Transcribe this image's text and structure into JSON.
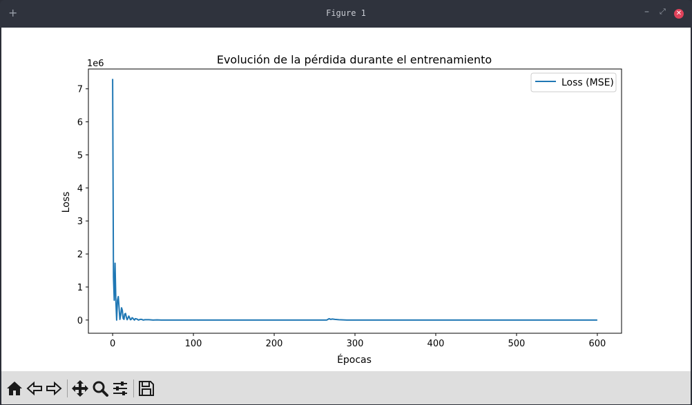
{
  "window": {
    "title": "Figure 1",
    "controls": {
      "add": "+",
      "minimize": "–",
      "maximize": "⤢",
      "close": "✕"
    }
  },
  "toolbar": {
    "icons": [
      "home-icon",
      "back-arrow-icon",
      "forward-arrow-icon",
      "pan-icon",
      "zoom-icon",
      "configure-subplots-icon",
      "save-icon"
    ]
  },
  "chart_data": {
    "type": "line",
    "title": "Evolución de la pérdida durante el entrenamiento",
    "xlabel": "Épocas",
    "ylabel": "Loss",
    "y_offset_label": "1e6",
    "xlim": [
      -30,
      630
    ],
    "ylim": [
      -0.4,
      7.6
    ],
    "xticks": [
      0,
      100,
      200,
      300,
      400,
      500,
      600
    ],
    "yticks": [
      0,
      1,
      2,
      3,
      4,
      5,
      6,
      7
    ],
    "legend": {
      "position": "top-right",
      "entries": [
        "Loss (MSE)"
      ]
    },
    "grid": false,
    "series": [
      {
        "name": "Loss (MSE)",
        "color": "#1f77b4",
        "x": [
          0,
          1,
          2,
          3,
          4,
          5,
          6,
          7,
          8,
          9,
          10,
          11,
          12,
          13,
          14,
          15,
          16,
          17,
          18,
          19,
          20,
          21,
          22,
          23,
          24,
          25,
          26,
          27,
          28,
          30,
          32,
          34,
          36,
          38,
          40,
          45,
          50,
          55,
          60,
          70,
          80,
          100,
          150,
          200,
          250,
          265,
          268,
          270,
          272,
          275,
          280,
          290,
          300,
          400,
          500,
          600
        ],
        "y": [
          7.3,
          1.3,
          0.6,
          1.72,
          0.55,
          0.0,
          0.6,
          0.71,
          0.38,
          0.02,
          0.15,
          0.37,
          0.3,
          0.05,
          0.02,
          0.18,
          0.2,
          0.08,
          0.01,
          0.06,
          0.12,
          0.07,
          0.01,
          0.02,
          0.07,
          0.06,
          0.02,
          0.0,
          0.04,
          0.03,
          0.0,
          0.02,
          0.02,
          0.0,
          0.01,
          0.01,
          0.0,
          0.005,
          0.0,
          0.0,
          0.0,
          0.0,
          0.0,
          0.0,
          0.0,
          0.0,
          0.04,
          0.02,
          0.03,
          0.02,
          0.01,
          0.0,
          0.0,
          0.0,
          0.0,
          0.0
        ]
      }
    ]
  }
}
